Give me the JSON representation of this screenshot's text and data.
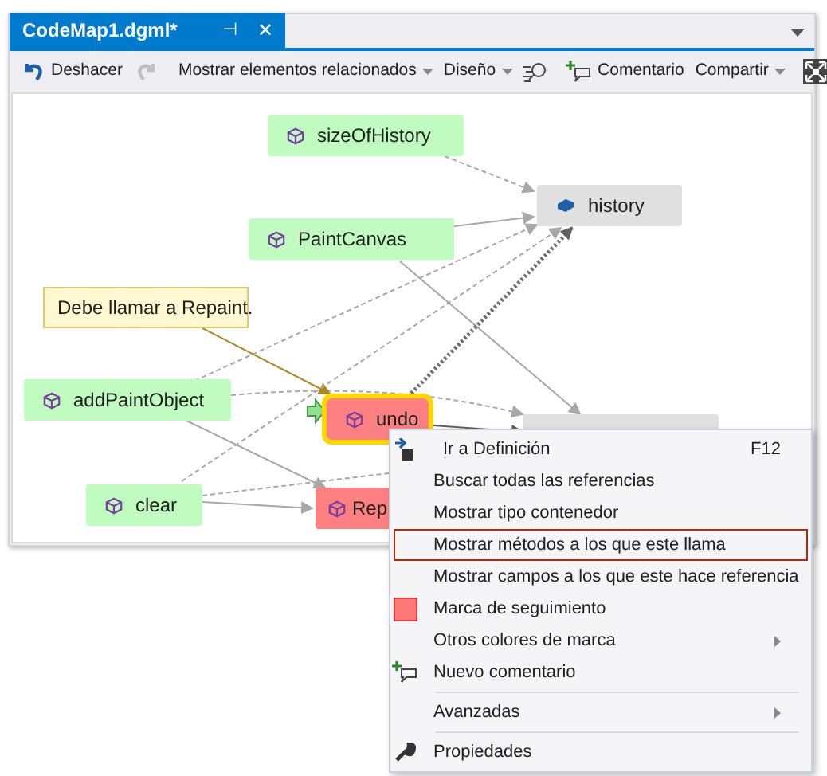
{
  "tab": {
    "title": "CodeMap1.dgml*",
    "pin": "⊣",
    "close": "✕"
  },
  "toolbar": [
    {
      "kind": "undo",
      "label": "Deshacer",
      "disabled": false
    },
    {
      "kind": "redo",
      "disabled": true
    },
    {
      "kind": "dropdown",
      "label": "Mostrar elementos relacionados"
    },
    {
      "kind": "dropdown",
      "label": "Diseño"
    },
    {
      "kind": "layout"
    },
    {
      "kind": "comment",
      "label": "Comentario"
    },
    {
      "kind": "dropdown",
      "label": "Compartir"
    },
    {
      "kind": "fit"
    }
  ],
  "nodes": [
    {
      "kind": "member",
      "label": "sizeOfHistory",
      "color": "#c0fcc0"
    },
    {
      "kind": "field",
      "label": "history",
      "color": "#e0e0e0"
    },
    {
      "kind": "member",
      "label": "PaintCanvas",
      "color": "#c0fcc0"
    },
    {
      "kind": "comment",
      "label": "Debe llamar a Repaint.",
      "color": "#fff8d0"
    },
    {
      "kind": "member",
      "label": "addPaintObject",
      "color": "#c0fcc0"
    },
    {
      "kind": "member",
      "label": "undo",
      "color": "#ff8080",
      "selected": true
    },
    {
      "kind": "blank",
      "color": "#e0e0e0"
    },
    {
      "kind": "member",
      "label": "clear",
      "color": "#c0fcc0"
    },
    {
      "kind": "member",
      "label": "Rep",
      "color": "#ff8080"
    }
  ],
  "context_menu": [
    {
      "kind": "goto",
      "label": "Ir a Definición",
      "shortcut": "F12",
      "selected": false
    },
    {
      "kind": "item",
      "label": "Buscar todas las referencias",
      "selected": false
    },
    {
      "kind": "item",
      "label": "Mostrar tipo contenedor",
      "selected": false
    },
    {
      "kind": "item",
      "label": "Mostrar métodos a los que este llama",
      "selected": true
    },
    {
      "kind": "item",
      "label": "Mostrar campos a los que este hace referencia",
      "selected": false
    },
    {
      "kind": "swatch",
      "label": "Marca de seguimiento",
      "selected": false
    },
    {
      "kind": "submenu",
      "label": "Otros colores de marca",
      "selected": false
    },
    {
      "kind": "comment",
      "label": "Nuevo comentario",
      "selected": false
    },
    {
      "kind": "separator"
    },
    {
      "kind": "submenu",
      "label": "Avanzadas",
      "selected": false
    },
    {
      "kind": "separator"
    },
    {
      "kind": "wrench",
      "label": "Propiedades",
      "selected": false
    }
  ]
}
